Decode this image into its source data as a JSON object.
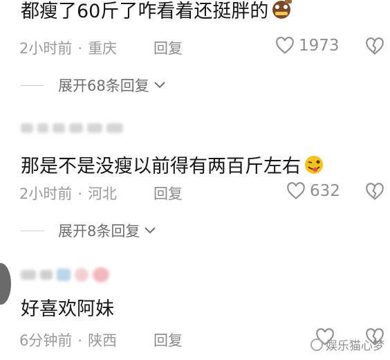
{
  "comments": [
    {
      "text": "都瘦了60斤了咋看着还挺胖的",
      "emoji": "money-mouth-emoji",
      "time": "2小时前",
      "location": "重庆",
      "reply_label": "回复",
      "likes": "1973",
      "expand_label": "展开68条回复"
    },
    {
      "text": "那是不是没瘦以前得有两百斤左右",
      "emoji": "winking-tongue-emoji",
      "time": "2小时前",
      "location": "河北",
      "reply_label": "回复",
      "likes": "632",
      "expand_label": "展开8条回复"
    },
    {
      "text": "好喜欢阿妹",
      "time": "6分钟前",
      "location": "陕西",
      "reply_label": "回复"
    }
  ],
  "separator": "·",
  "watermark": "娱乐猫心梦",
  "icons": {
    "like": "heart-outline-icon",
    "dislike": "broken-heart-icon",
    "expand": "chevron-down-icon"
  },
  "colors": {
    "text": "#161616",
    "meta": "#9a9a9a",
    "icon": "#8e8e8e"
  }
}
